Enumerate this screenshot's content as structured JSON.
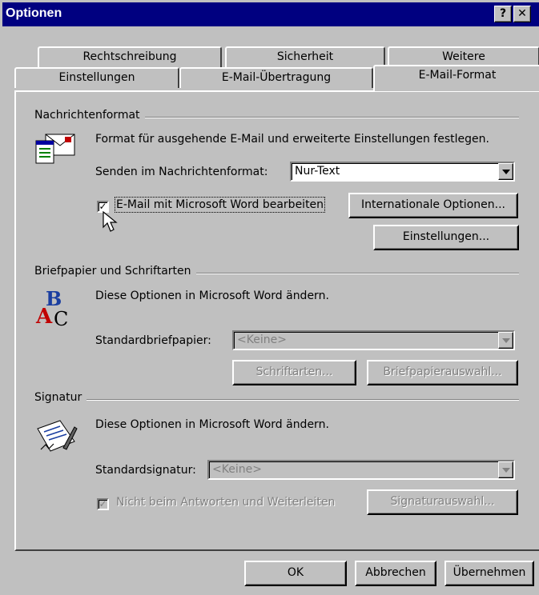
{
  "window": {
    "title": "Optionen",
    "help_button": "?",
    "close_button": "✕"
  },
  "tabs": {
    "row_back": [
      "Rechtschreibung",
      "Sicherheit",
      "Weitere"
    ],
    "row_front": [
      "Einstellungen",
      "E-Mail-Übertragung",
      "E-Mail-Format"
    ],
    "active": "E-Mail-Format"
  },
  "nachrichtenformat": {
    "section_label": "Nachrichtenformat",
    "description": "Format für ausgehende E-Mail und erweiterte Einstellungen festlegen.",
    "format_label": "Senden im Nachrichtenformat:",
    "format_value": "Nur-Text",
    "word_checkbox_label": "E-Mail mit Microsoft Word bearbeiten",
    "word_checkbox_checked": true,
    "international_button": "Internationale Optionen...",
    "settings_button": "Einstellungen..."
  },
  "briefpapier": {
    "section_label": "Briefpapier und Schriftarten",
    "description": "Diese Optionen in Microsoft Word ändern.",
    "stationery_label": "Standardbriefpapier:",
    "stationery_value": "<Keine>",
    "fonts_button": "Schriftarten...",
    "stationery_button": "Briefpapierauswahl..."
  },
  "signatur": {
    "section_label": "Signatur",
    "description": "Diese Optionen in Microsoft Word ändern.",
    "signature_label": "Standardsignatur:",
    "signature_value": "<Keine>",
    "no_reply_checkbox_label": "Nicht beim Antworten und Weiterleiten",
    "no_reply_checkbox_checked": true,
    "signature_button": "Signaturauswahl..."
  },
  "footer": {
    "ok": "OK",
    "cancel": "Abbrechen",
    "apply": "Übernehmen"
  }
}
